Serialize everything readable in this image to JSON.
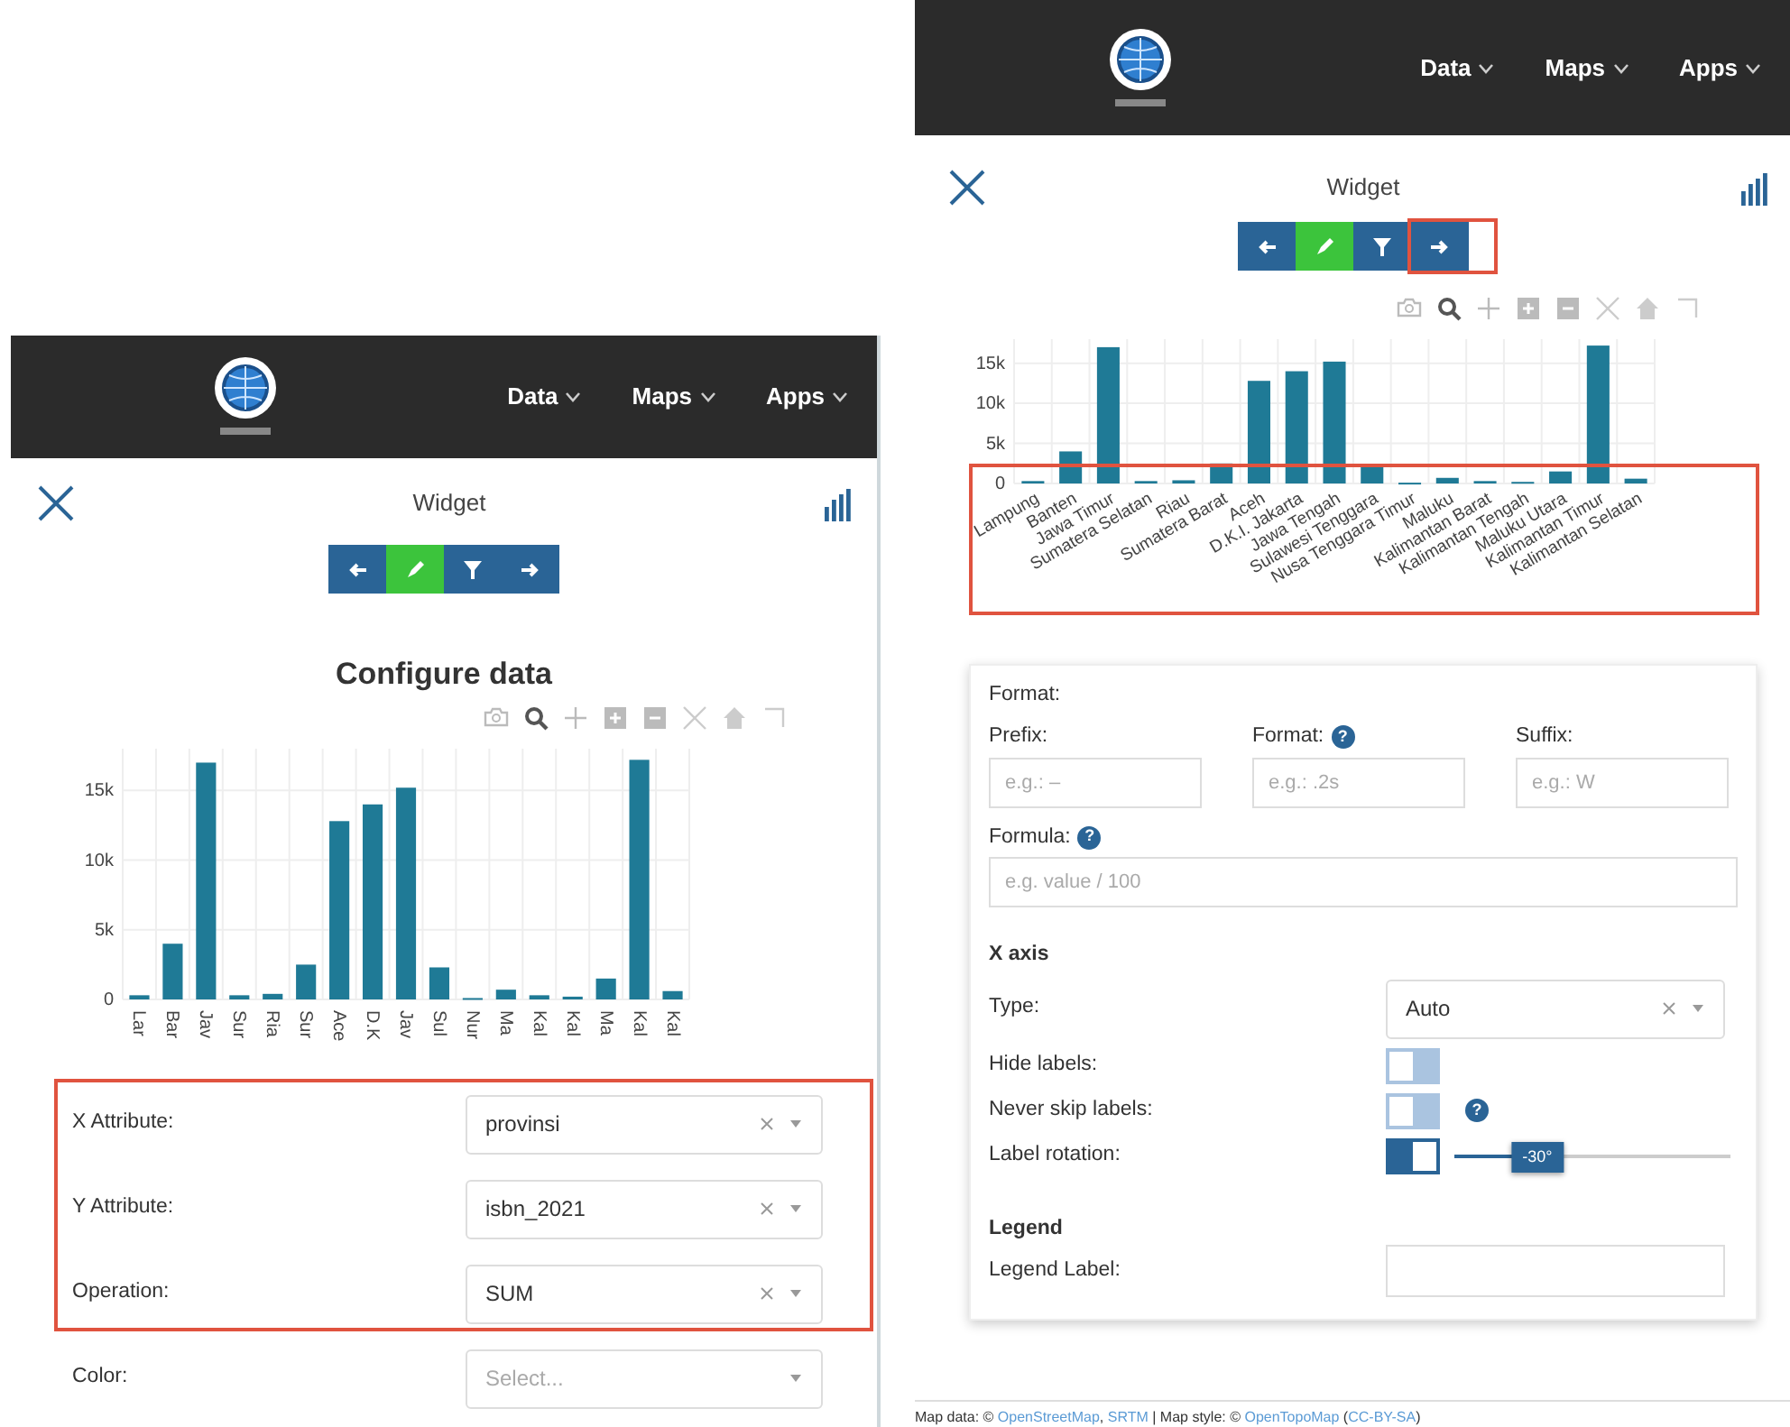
{
  "panels": [
    {
      "navbar": {
        "menus": [
          {
            "label": "Data"
          },
          {
            "label": "Maps"
          },
          {
            "label": "Apps"
          }
        ]
      },
      "widget_title": "Widget",
      "steps": [
        {
          "kind": "back",
          "selected": false
        },
        {
          "kind": "edit",
          "selected": true
        },
        {
          "kind": "filter",
          "selected": false
        },
        {
          "kind": "next",
          "selected": false
        }
      ],
      "heading": "Configure data",
      "chart_data": {
        "type": "bar",
        "categories": [
          "Lar",
          "Bar",
          "Jav",
          "Sur",
          "Ria",
          "Sur",
          "Ace",
          "D.K",
          "Jav",
          "Sul",
          "Nur",
          "Ma",
          "Kal",
          "Kal",
          "Ma",
          "Kal",
          "Kal"
        ],
        "series": [
          {
            "color": "#1f7a96",
            "values": [
              300,
              4000,
              17000,
              300,
              400,
              2500,
              12800,
              14000,
              15200,
              2300,
              100,
              700,
              300,
              200,
              1500,
              17200,
              600
            ]
          }
        ],
        "ylim": [
          0,
          18000
        ],
        "grid": true,
        "yticks": [
          {
            "value": 0,
            "label": "0"
          },
          {
            "value": 5000,
            "label": "5k"
          },
          {
            "value": 10000,
            "label": "10k"
          },
          {
            "value": 15000,
            "label": "15k"
          }
        ]
      },
      "fields": [
        {
          "kind": "select",
          "label": "X Attribute:",
          "value": "provinsi"
        },
        {
          "kind": "select",
          "label": "Y Attribute:",
          "value": "isbn_2021"
        },
        {
          "kind": "select",
          "label": "Operation:",
          "value": "SUM"
        },
        {
          "kind": "select",
          "label": "Color:",
          "placeholder": "Select..."
        }
      ]
    },
    {
      "navbar": {
        "menus": [
          {
            "label": "Data"
          },
          {
            "label": "Maps"
          },
          {
            "label": "Apps"
          }
        ]
      },
      "widget_title": "Widget",
      "steps": [
        {
          "kind": "back",
          "selected": false
        },
        {
          "kind": "edit",
          "selected": true
        },
        {
          "kind": "filter",
          "selected": false
        },
        {
          "kind": "next",
          "selected": false
        }
      ],
      "chart_data": {
        "type": "bar",
        "categories": [
          "Lampung",
          "Banten",
          "Jawa Timur",
          "Sumatera Selatan",
          "Riau",
          "Sumatera Barat",
          "Aceh",
          "D.K.I. Jakarta",
          "Jawa Tengah",
          "Sulawesi Tenggara",
          "Nusa Tenggara Timur",
          "Maluku",
          "Kalimantan Barat",
          "Kalimantan Tengah",
          "Maluku Utara",
          "Kalimantan Timur",
          "Kalimantan Selatan"
        ],
        "series": [
          {
            "color": "#1f7a96",
            "values": [
              300,
              4000,
              17000,
              300,
              400,
              2500,
              12800,
              14000,
              15200,
              2300,
              100,
              700,
              300,
              200,
              1500,
              17200,
              600
            ]
          }
        ],
        "ylim": [
          0,
          18000
        ],
        "grid": true,
        "yticks": [
          {
            "value": 0,
            "label": "0"
          },
          {
            "value": 5000,
            "label": "5k"
          },
          {
            "value": 10000,
            "label": "10k"
          },
          {
            "value": 15000,
            "label": "15k"
          }
        ]
      },
      "form": {
        "title": "Format:",
        "inputs": [
          {
            "label": "Prefix:",
            "placeholder": "e.g.: –"
          },
          {
            "label": "Format:",
            "help": "?",
            "placeholder": "e.g.: .2s"
          },
          {
            "label": "Suffix:",
            "placeholder": "e.g.: W"
          }
        ],
        "formula": {
          "label": "Formula:",
          "help": "?",
          "placeholder": "e.g. value / 100"
        },
        "x_axis": {
          "heading": "X axis",
          "rows": [
            {
              "kind": "select",
              "label": "Type:",
              "value": "Auto"
            },
            {
              "kind": "toggle",
              "label": "Hide labels:",
              "on": false
            },
            {
              "kind": "toggle",
              "label": "Never skip labels:",
              "on": false,
              "help": "?"
            },
            {
              "kind": "slider",
              "label": "Label rotation:",
              "on": true,
              "level": 0.3,
              "reading": "-30°"
            }
          ]
        },
        "legend": {
          "heading": "Legend",
          "label": "Legend Label:"
        }
      },
      "footer": [
        {
          "kind": "text",
          "text": "Map data: © "
        },
        {
          "kind": "link",
          "text": "OpenStreetMap"
        },
        {
          "kind": "text",
          "text": ", "
        },
        {
          "kind": "link",
          "text": "SRTM"
        },
        {
          "kind": "text",
          "text": " | Map style: © "
        },
        {
          "kind": "link",
          "text": "OpenTopoMap"
        },
        {
          "kind": "text",
          "text": " ("
        },
        {
          "kind": "link",
          "text": "CC-BY-SA"
        },
        {
          "kind": "text",
          "text": ")"
        }
      ]
    }
  ]
}
